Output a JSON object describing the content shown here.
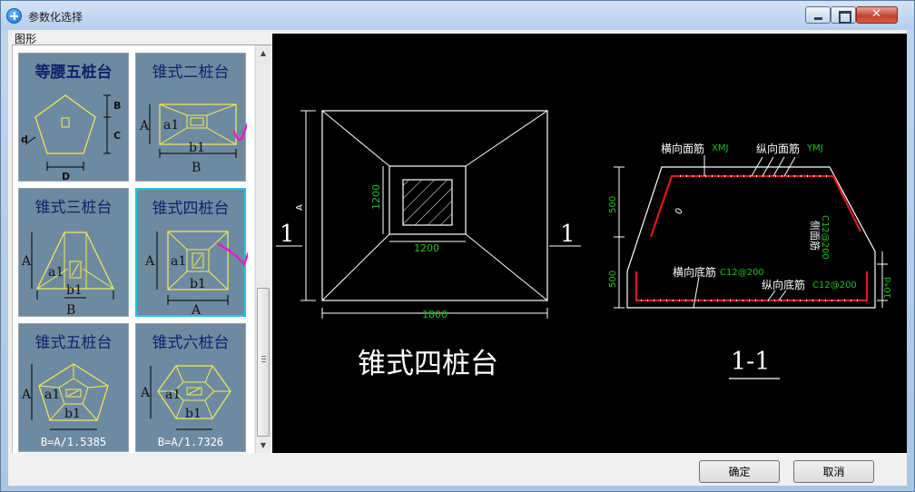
{
  "window": {
    "title": "参数化选择"
  },
  "left_panel": {
    "group_label": "图形",
    "thumbnails": [
      {
        "title": "等腰五桩台",
        "dims": [
          "B",
          "C",
          "D",
          "d"
        ],
        "formula": ""
      },
      {
        "title": "锥式二桩台",
        "dims": [
          "A",
          "a1",
          "b1",
          "B"
        ],
        "formula": ""
      },
      {
        "title": "锥式三桩台",
        "dims": [
          "A",
          "a1",
          "b1",
          "B"
        ],
        "formula": ""
      },
      {
        "title": "锥式四桩台",
        "dims": [
          "A",
          "a1",
          "b1",
          "A"
        ],
        "formula": ""
      },
      {
        "title": "锥式五桩台",
        "dims": [
          "A",
          "a1",
          "b1"
        ],
        "formula": "B=A/1.5385"
      },
      {
        "title": "锥式六桩台",
        "dims": [
          "A",
          "a1",
          "b1"
        ],
        "formula": "B=A/1.7326"
      }
    ],
    "selected_index": 3
  },
  "preview": {
    "caption": "锥式四桩台",
    "section_mark": "1",
    "section_title": "1-1",
    "dim_inner_height": "1200",
    "dim_inner_width": "1200",
    "dim_outer": "1800",
    "dim_side": "A",
    "labels": {
      "top_trans": "横向面筋",
      "top_trans_code": "XMJ",
      "top_long": "纵向面筋",
      "top_long_code": "YMJ",
      "side_bar": "侧面筋",
      "side_bar_code": "C12@200",
      "bot_trans": "横向底筋",
      "bot_trans_code": "C12@200",
      "bot_long": "纵向底筋",
      "bot_long_code": "C12@200",
      "dim_500_top": "500",
      "dim_500_bot": "500",
      "dim_cover": "10*d",
      "zero": "0"
    }
  },
  "buttons": {
    "ok": "确定",
    "cancel": "取消"
  },
  "colors": {
    "thumb_bg": "#6e8aa0",
    "thumb_title": "#13206b",
    "selected_border": "#1ec7e6",
    "rebar": "#e01818",
    "dim_green": "#19c219",
    "checkmark": "#e020c8"
  }
}
